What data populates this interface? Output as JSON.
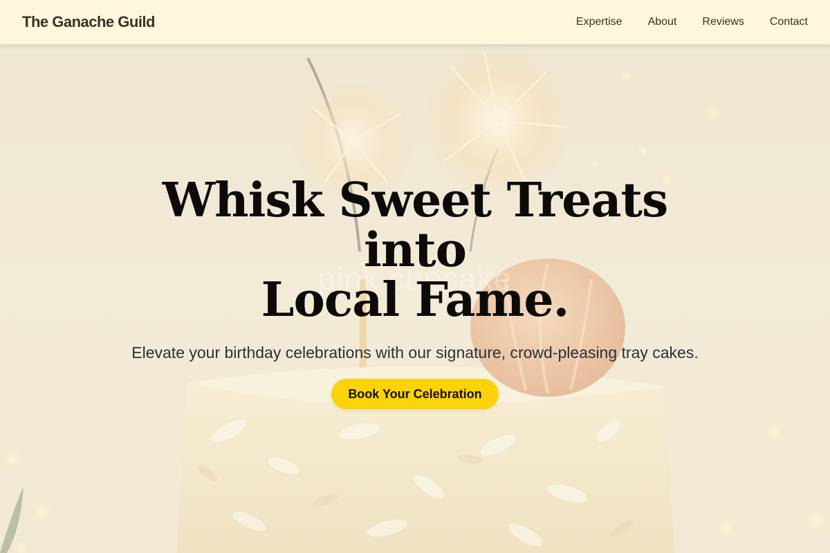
{
  "brand": {
    "name": "The Ganache Guild"
  },
  "nav": {
    "items": [
      {
        "label": "Expertise"
      },
      {
        "label": "About"
      },
      {
        "label": "Reviews"
      },
      {
        "label": "Contact"
      }
    ]
  },
  "hero": {
    "title_line1": "Whisk Sweet Treats into",
    "title_line2": "Local Fame.",
    "subtitle": "Elevate your birthday celebrations with our signature, crowd-pleasing tray cakes.",
    "cta_label": "Book Your Celebration",
    "background_alt_text": "pink cupcake"
  },
  "colors": {
    "header_bg": "#fef7dc",
    "cta_bg": "#fcd209",
    "title_text": "#0c0b09",
    "body_text": "#2d2f38"
  }
}
